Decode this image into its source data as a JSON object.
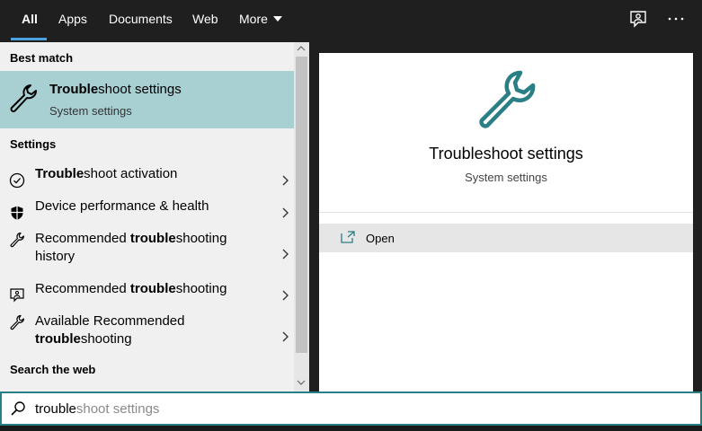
{
  "tabs": [
    {
      "label": "All"
    },
    {
      "label": "Apps"
    },
    {
      "label": "Documents"
    },
    {
      "label": "Web"
    },
    {
      "label": "More"
    }
  ],
  "best_match": {
    "heading": "Best match",
    "title_bold": "Trouble",
    "title_rest": "shoot settings",
    "subtitle": "System settings"
  },
  "settings": {
    "heading": "Settings",
    "items": [
      {
        "pre": "",
        "bold": "Trouble",
        "post": "shoot activation",
        "line2_pre": "",
        "line2_bold": "",
        "line2_post": ""
      },
      {
        "pre": "Device performance & health",
        "bold": "",
        "post": "",
        "line2_pre": "",
        "line2_bold": "",
        "line2_post": ""
      },
      {
        "pre": "Recommended ",
        "bold": "trouble",
        "post": "shooting",
        "line2_pre": "history",
        "line2_bold": "",
        "line2_post": ""
      },
      {
        "pre": "Recommended ",
        "bold": "trouble",
        "post": "shooting",
        "line2_pre": "",
        "line2_bold": "",
        "line2_post": ""
      },
      {
        "pre": "Available Recommended",
        "bold": "",
        "post": "",
        "line2_pre": "",
        "line2_bold": "trouble",
        "line2_post": "shooting"
      }
    ]
  },
  "web": {
    "heading": "Search the web"
  },
  "preview": {
    "title": "Troubleshoot settings",
    "subtitle": "System settings",
    "open_label": "Open"
  },
  "search": {
    "typed": "trouble",
    "suggestion": "shoot settings"
  },
  "colors": {
    "accent": "#2a7f86",
    "selected_bg": "#a8d0d3",
    "tab_underline": "#4aa3df"
  }
}
